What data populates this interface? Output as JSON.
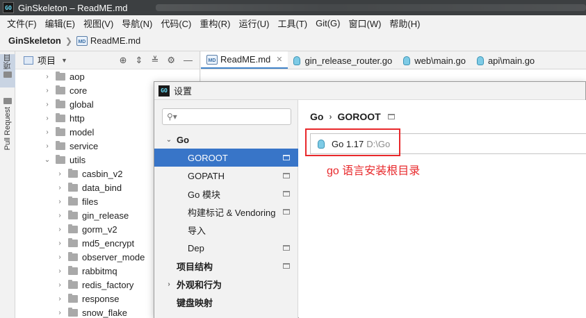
{
  "window": {
    "title": "GinSkeleton – ReadME.md",
    "logo_text": "GO"
  },
  "menubar": [
    "文件(F)",
    "编辑(E)",
    "视图(V)",
    "导航(N)",
    "代码(C)",
    "重构(R)",
    "运行(U)",
    "工具(T)",
    "Git(G)",
    "窗口(W)",
    "帮助(H)"
  ],
  "navbar": {
    "project": "GinSkeleton",
    "file": "ReadME.md",
    "md_badge": "MD"
  },
  "left_strip": {
    "project_label": "项目",
    "pull_request_label": "Pull Request"
  },
  "project_panel": {
    "title": "项目",
    "tree": [
      {
        "label": "aop",
        "depth": 0
      },
      {
        "label": "core",
        "depth": 0
      },
      {
        "label": "global",
        "depth": 0
      },
      {
        "label": "http",
        "depth": 0
      },
      {
        "label": "model",
        "depth": 0
      },
      {
        "label": "service",
        "depth": 0
      },
      {
        "label": "utils",
        "depth": 0,
        "expanded": true
      },
      {
        "label": "casbin_v2",
        "depth": 1
      },
      {
        "label": "data_bind",
        "depth": 1
      },
      {
        "label": "files",
        "depth": 1
      },
      {
        "label": "gin_release",
        "depth": 1
      },
      {
        "label": "gorm_v2",
        "depth": 1
      },
      {
        "label": "md5_encrypt",
        "depth": 1
      },
      {
        "label": "observer_mode",
        "depth": 1
      },
      {
        "label": "rabbitmq",
        "depth": 1
      },
      {
        "label": "redis_factory",
        "depth": 1
      },
      {
        "label": "response",
        "depth": 1
      },
      {
        "label": "snow_flake",
        "depth": 1
      }
    ]
  },
  "editor_tabs": [
    {
      "label": "ReadME.md",
      "type": "md",
      "active": true
    },
    {
      "label": "gin_release_router.go",
      "type": "go"
    },
    {
      "label": "web\\main.go",
      "type": "go"
    },
    {
      "label": "api\\main.go",
      "type": "go"
    }
  ],
  "dialog": {
    "title": "设置",
    "search": {
      "value": "",
      "placeholder": ""
    },
    "items": [
      {
        "label": "Go",
        "level": 0,
        "expanded": true,
        "bold": true
      },
      {
        "label": "GOROOT",
        "level": 1,
        "selected": true,
        "mark": true
      },
      {
        "label": "GOPATH",
        "level": 1,
        "mark": true
      },
      {
        "label": "Go 模块",
        "level": 1,
        "mark": true
      },
      {
        "label": "构建标记 & Vendoring",
        "level": 1,
        "mark": true
      },
      {
        "label": "导入",
        "level": 1
      },
      {
        "label": "Dep",
        "level": 1,
        "mark": true
      },
      {
        "label": "项目结构",
        "level": 0,
        "bold": true,
        "mark": true
      },
      {
        "label": "外观和行为",
        "level": 0,
        "bold": true,
        "collapsed": true
      },
      {
        "label": "键盘映射",
        "level": 0,
        "bold": true
      }
    ],
    "breadcrumb": [
      "Go",
      "GOROOT"
    ],
    "sdk": {
      "version": "Go 1.17",
      "path": "D:\\Go"
    },
    "annotation": "go 语言安装根目录"
  },
  "colors": {
    "selection": "#3875c8",
    "annotation": "#e8282b",
    "tab_underline": "#4083c9"
  }
}
